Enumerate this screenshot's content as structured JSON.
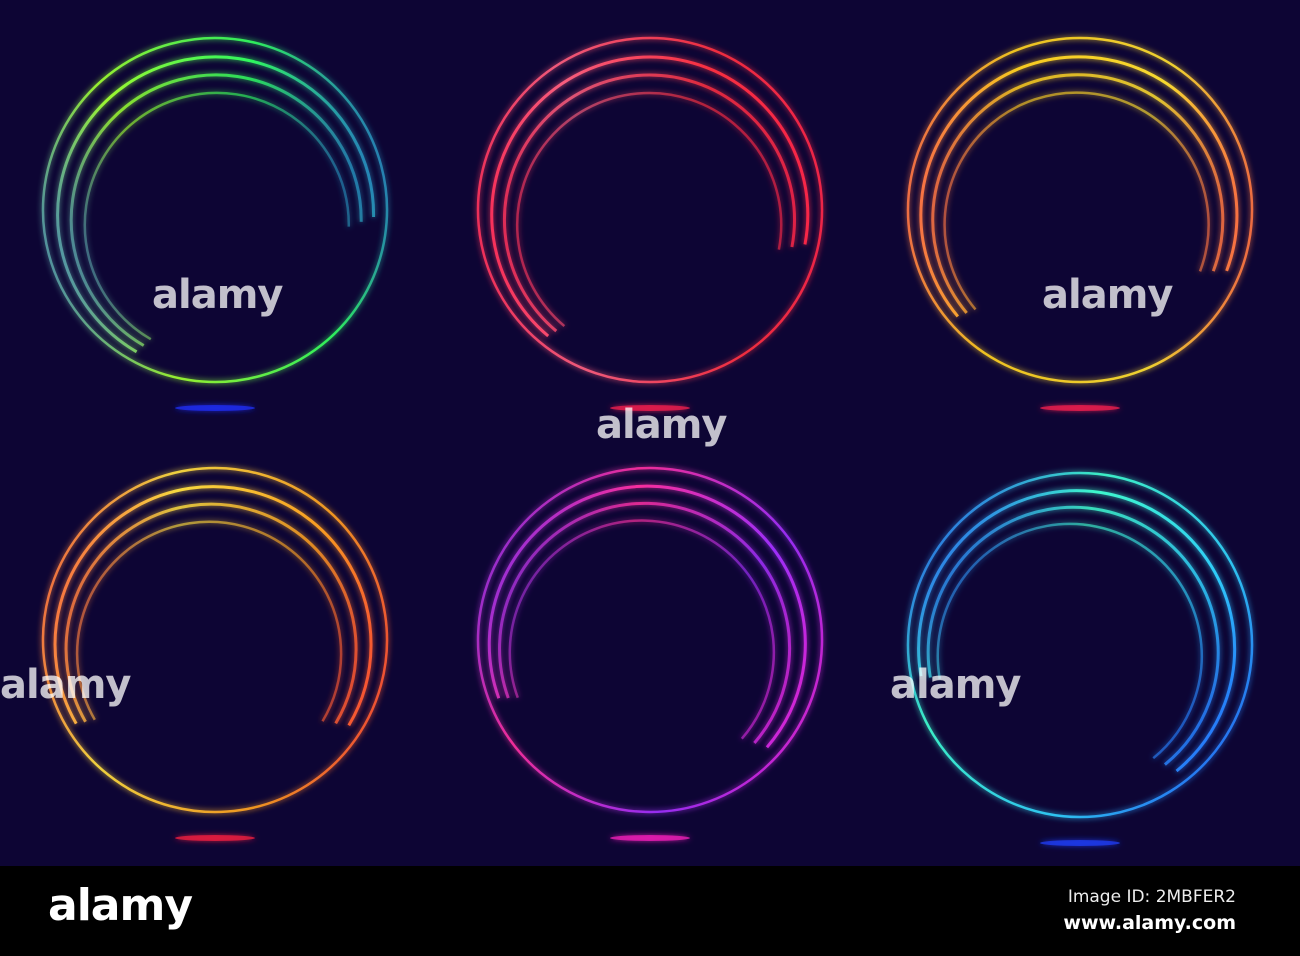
{
  "watermark": {
    "text": "alamy",
    "small": "a"
  },
  "footer": {
    "logo": "alamy",
    "image_id": "Image ID: 2MBFER2",
    "url": "www.alamy.com"
  },
  "rings": [
    {
      "name": "green-blue-ring",
      "colors": [
        "#2030ff",
        "#30ff60",
        "#a0ff30",
        "#2050ff"
      ]
    },
    {
      "name": "red-pink-ring",
      "colors": [
        "#ff2050",
        "#ff3040",
        "#ff6080",
        "#ff1040"
      ]
    },
    {
      "name": "yellow-red-ring",
      "colors": [
        "#ff2050",
        "#ffe030",
        "#ffd020",
        "#ff3060"
      ]
    },
    {
      "name": "orange-red-ring",
      "colors": [
        "#ff2040",
        "#ffa020",
        "#ffe040",
        "#ff3040"
      ]
    },
    {
      "name": "magenta-purple-ring",
      "colors": [
        "#ff20c0",
        "#a030ff",
        "#ff30a0",
        "#6030ff"
      ]
    },
    {
      "name": "blue-cyan-ring",
      "colors": [
        "#2040ff",
        "#30d0ff",
        "#40ffd0",
        "#2030ff"
      ]
    }
  ]
}
